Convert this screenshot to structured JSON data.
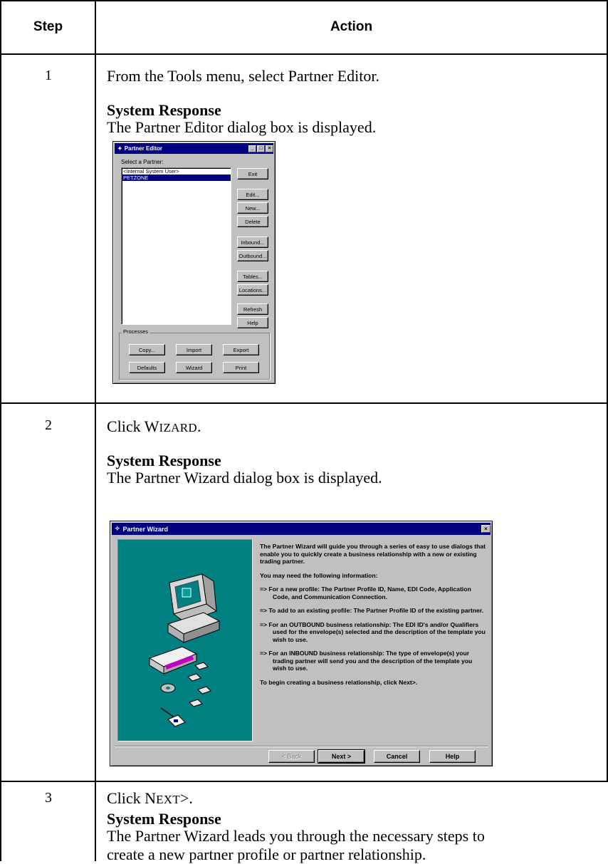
{
  "table": {
    "headers": {
      "step": "Step",
      "action": "Action"
    },
    "rows": [
      {
        "step": "1",
        "action": "From the Tools menu, select Partner Editor.",
        "response_heading": "System Response",
        "response_text": "The Partner Editor dialog box is displayed."
      },
      {
        "step": "2",
        "action_prefix": "Click ",
        "action_caps_first": "W",
        "action_caps_rest": "IZARD",
        "action_suffix": ".",
        "response_heading": "System Response",
        "response_text": "The Partner Wizard dialog box is displayed."
      },
      {
        "step": "3",
        "action_prefix": "Click ",
        "action_caps_first": "N",
        "action_caps_rest": "EXT",
        "action_suffix": ">.",
        "response_heading": "System Response",
        "response_text_line1": "The Partner Wizard leads you through the necessary steps to",
        "response_text_line2": "create a new partner profile or partner relationship."
      }
    ]
  },
  "partner_editor": {
    "title": "Partner Editor",
    "select_label": "Select a Partner:",
    "partners": [
      "<Internal System User>",
      "PETZONE"
    ],
    "selected_partner": "PETZONE",
    "buttons": {
      "exit": "Exit",
      "edit": "Edit...",
      "new": "New...",
      "delete": "Delete",
      "inbound": "Inbound...",
      "outbound": "Outbound...",
      "tables": "Tables...",
      "locations": "Locations...",
      "refresh": "Refresh",
      "help": "Help"
    },
    "processes_label": "Processes",
    "process_buttons": {
      "copy": "Copy...",
      "import": "Import",
      "export": "Export",
      "defaults": "Defaults",
      "wizard": "Wizard",
      "print": "Print"
    }
  },
  "partner_wizard": {
    "title": "Partner Wizard",
    "intro": "The Partner Wizard will guide you through a series of easy to use dialogs that enable you to quickly create a business relationship with a new or existing trading partner.",
    "need_info": "You may need the following information:",
    "items": [
      "=>  For a new profile:  The Partner Profile ID, Name, EDI Code, Application Code, and Communication Connection.",
      "=>  To add to an existing profile:  The Partner Profile ID of the existing partner.",
      "=>  For an OUTBOUND business relationship:  The EDI ID's and/or Qualifiers used for the envelope(s) selected and the description of the template you wish to use.",
      "=>  For an INBOUND business relationship:  The type of envelope(s) your trading partner will send you and the description of the template you wish to use."
    ],
    "footer": "To begin creating a business relationship, click Next>.",
    "buttons": {
      "back": "< Back",
      "next": "Next >",
      "cancel": "Cancel",
      "help": "Help"
    }
  }
}
